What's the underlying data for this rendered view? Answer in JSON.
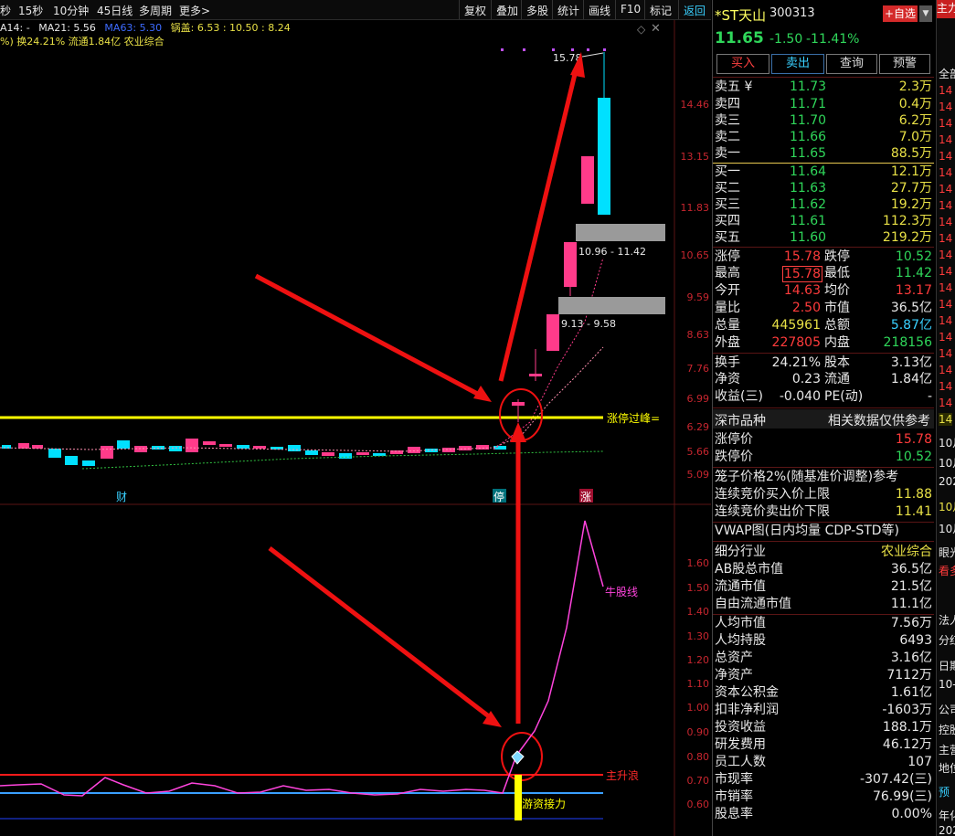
{
  "toolbar": {
    "periods": [
      "秒",
      "15秒",
      "10分钟",
      "45日线",
      "多周期",
      "更多>"
    ],
    "buttons": [
      "复权",
      "叠加",
      "多股",
      "统计",
      "画线",
      "F10",
      "标记",
      "返回"
    ]
  },
  "indicators": {
    "line1_ma14": "A14: -",
    "line1_ma21": "MA21: 5.56",
    "line1_ma63": "MA63: 5.30",
    "line1_guo": "锅盖: 6.53 : 10.50 : 8.24",
    "line2": "%) 换24.21% 流通1.84亿 农业综合"
  },
  "price_axis": [
    "14.46",
    "13.15",
    "11.83",
    "10.65",
    "9.59",
    "8.63",
    "7.76",
    "6.99",
    "6.29",
    "5.66",
    "5.09"
  ],
  "lower_axis": [
    "1.60",
    "1.50",
    "1.40",
    "1.30",
    "1.20",
    "1.10",
    "1.00",
    "0.90",
    "0.80",
    "0.70",
    "0.60"
  ],
  "chart_labels": {
    "high": "15.78",
    "range_upper": "10.96 - 11.42",
    "range_lower": "9.13 - 9.58",
    "limit_line": "涨停过峰=",
    "marker_cai": "财",
    "marker_ting": "停",
    "marker_zhang": "涨",
    "bull_line": "牛股线",
    "main_wave": "主升浪",
    "hot_money": "游资接力"
  },
  "stock": {
    "name": "*ST天山",
    "code": "300313",
    "add_fav": "+自选",
    "price": "11.65",
    "change": "-1.50",
    "change_pct": "-11.41%"
  },
  "actions": [
    "买入",
    "卖出",
    "查询",
    "预警"
  ],
  "asks": [
    {
      "label": "卖五 ¥",
      "price": "11.73",
      "vol": "2.3万"
    },
    {
      "label": "卖四",
      "price": "11.71",
      "vol": "0.4万"
    },
    {
      "label": "卖三",
      "price": "11.70",
      "vol": "6.2万"
    },
    {
      "label": "卖二",
      "price": "11.66",
      "vol": "7.0万"
    },
    {
      "label": "卖一",
      "price": "11.65",
      "vol": "88.5万"
    }
  ],
  "bids": [
    {
      "label": "买一",
      "price": "11.64",
      "vol": "12.1万"
    },
    {
      "label": "买二",
      "price": "11.63",
      "vol": "27.7万"
    },
    {
      "label": "买三",
      "price": "11.62",
      "vol": "19.2万"
    },
    {
      "label": "买四",
      "price": "11.61",
      "vol": "112.3万"
    },
    {
      "label": "买五",
      "price": "11.60",
      "vol": "219.2万"
    }
  ],
  "quote": [
    {
      "l1": "涨停",
      "v1": "15.78",
      "l2": "跌停",
      "v2": "10.52"
    },
    {
      "l1": "最高",
      "v1": "15.78",
      "l2": "最低",
      "v2": "11.42"
    },
    {
      "l1": "今开",
      "v1": "14.63",
      "l2": "均价",
      "v2": "13.17"
    },
    {
      "l1": "量比",
      "v1": "2.50",
      "l2": "市值",
      "v2": "36.5亿"
    },
    {
      "l1": "总量",
      "v1": "445961",
      "l2": "总额",
      "v2": "5.87亿"
    },
    {
      "l1": "外盘",
      "v1": "227805",
      "l2": "内盘",
      "v2": "218156"
    },
    {
      "l1": "换手",
      "v1": "24.21%",
      "l2": "股本",
      "v2": "3.13亿"
    },
    {
      "l1": "净资",
      "v1": "0.23",
      "l2": "流通",
      "v2": "1.84亿"
    },
    {
      "l1": "收益(三)",
      "v1": "-0.040",
      "l2": "PE(动)",
      "v2": "-"
    }
  ],
  "market": {
    "title": "深市品种",
    "note": "相关数据仅供参考",
    "rows": [
      {
        "label": "涨停价",
        "value": "15.78"
      },
      {
        "label": "跌停价",
        "value": "10.52"
      }
    ],
    "cage": "笼子价格2%(随基准价调整)参考",
    "cage_rows": [
      {
        "label": "连续竞价买入价上限",
        "value": "11.88"
      },
      {
        "label": "连续竞价卖出价下限",
        "value": "11.41"
      }
    ],
    "vwap": "VWAP图(日内均量 CDP-STD等)"
  },
  "fundamentals": [
    {
      "label": "细分行业",
      "value": "农业综合"
    },
    {
      "label": "AB股总市值",
      "value": "36.5亿"
    },
    {
      "label": "流通市值",
      "value": "21.5亿"
    },
    {
      "label": "自由流通市值",
      "value": "11.1亿"
    },
    {
      "label": "人均市值",
      "value": "7.56万"
    },
    {
      "label": "人均持股",
      "value": "6493"
    },
    {
      "label": "总资产",
      "value": "3.16亿"
    },
    {
      "label": "净资产",
      "value": "7112万"
    },
    {
      "label": "资本公积金",
      "value": "1.61亿"
    },
    {
      "label": "扣非净利润",
      "value": "-1603万"
    },
    {
      "label": "投资收益",
      "value": "188.1万"
    },
    {
      "label": "研发费用",
      "value": "46.12万"
    },
    {
      "label": "员工人数",
      "value": "107"
    },
    {
      "label": "市现率",
      "value": "-307.42(三)"
    },
    {
      "label": "市销率",
      "value": "76.99(三)"
    },
    {
      "label": "股息率",
      "value": "0.00%"
    }
  ],
  "far_right": [
    "主力",
    "全部",
    "14",
    "14",
    "14",
    "14",
    "14",
    "14",
    "14",
    "14",
    "14",
    "14",
    "14",
    "14",
    "14",
    "14",
    "14",
    "14",
    "14",
    "14",
    "14",
    "14",
    "14",
    "14",
    "10月",
    "10月",
    "202",
    "10月",
    "10月",
    "眼光",
    "看多",
    "法人",
    "分红",
    "日期",
    "10-",
    "公司",
    "控股",
    "主营",
    "地位",
    "预",
    "年化",
    "202"
  ],
  "colors": {
    "up": "#ff3b3b",
    "down": "#2fd65a",
    "limit_line": "#ffff00",
    "bull_line": "#ff44dd",
    "main_wave": "#ff2020",
    "arrow": "#ee1111"
  }
}
